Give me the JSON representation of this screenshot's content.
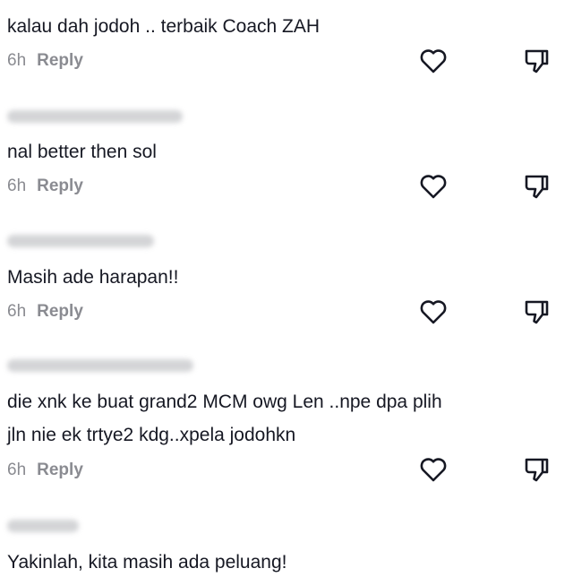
{
  "comments": [
    {
      "username": "",
      "text_lines": [
        "kalau dah jodoh .. terbaik Coach ZAH"
      ],
      "time": "6h",
      "reply_label": "Reply",
      "like_icon": "heart-outline-icon",
      "dislike_icon": "thumbs-down-icon"
    },
    {
      "username": "",
      "text_lines": [
        "nal better then sol"
      ],
      "time": "6h",
      "reply_label": "Reply",
      "like_icon": "heart-outline-icon",
      "dislike_icon": "thumbs-down-icon"
    },
    {
      "username": "",
      "text_lines": [
        "Masih ade harapan!!"
      ],
      "time": "6h",
      "reply_label": "Reply",
      "like_icon": "heart-outline-icon",
      "dislike_icon": "thumbs-down-icon"
    },
    {
      "username": "",
      "text_lines": [
        "die xnk ke buat grand2 MCM owg Len ..npe dpa plih",
        "jln nie ek trtye2 kdg..xpela jodohkn"
      ],
      "time": "6h",
      "reply_label": "Reply",
      "like_icon": "heart-outline-icon",
      "dislike_icon": "thumbs-down-icon"
    },
    {
      "username": "",
      "text_lines": [
        "Yakinlah, kita masih ada peluang!"
      ],
      "time": "",
      "reply_label": "",
      "like_icon": "",
      "dislike_icon": ""
    }
  ],
  "colors": {
    "text": "#161823",
    "meta": "#8a8b91",
    "icon": "#161823",
    "username_blur": "#c9cacd"
  }
}
